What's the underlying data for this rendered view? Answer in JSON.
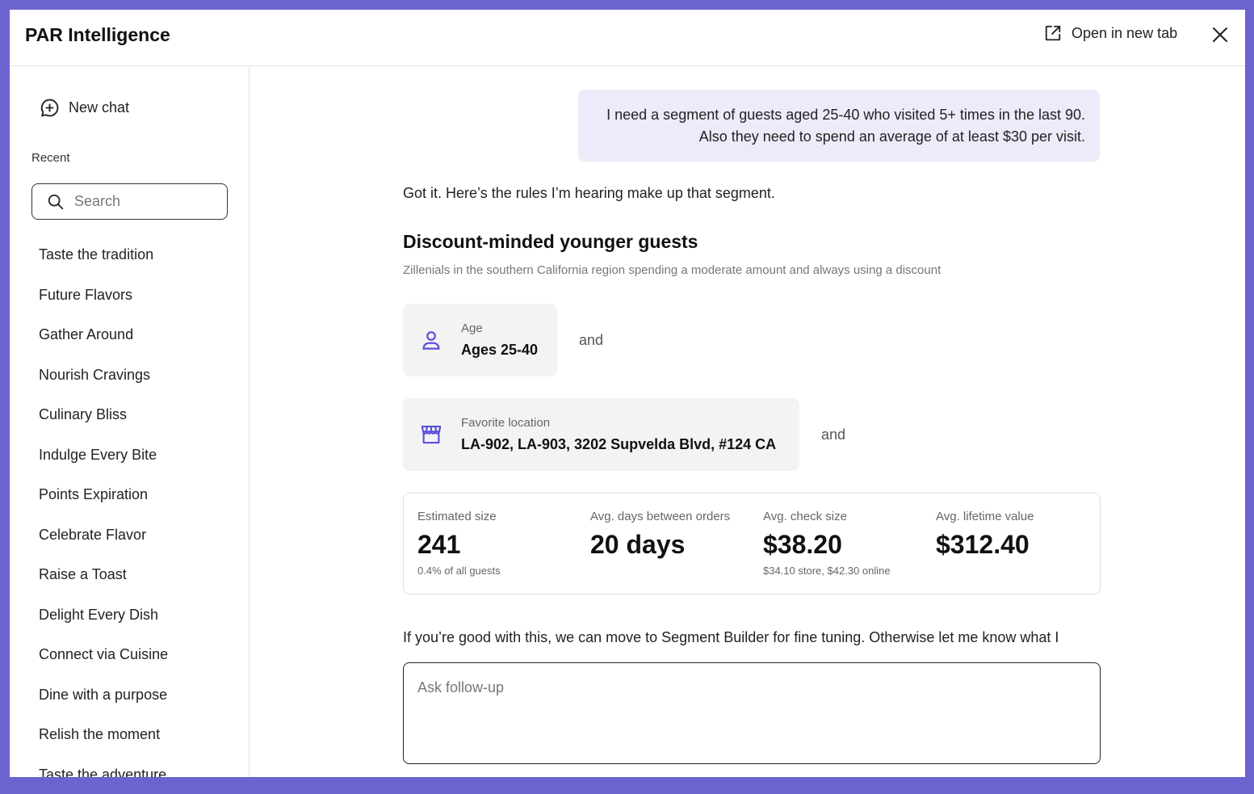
{
  "header": {
    "app_title": "PAR Intelligence",
    "open_new_tab_label": "Open in new tab"
  },
  "sidebar": {
    "new_chat_label": "New chat",
    "recent_label": "Recent",
    "search_placeholder": "Search",
    "recent_items": [
      "Taste the tradition",
      "Future Flavors",
      "Gather Around",
      "Nourish Cravings",
      "Culinary Bliss",
      "Indulge Every Bite",
      "Points Expiration",
      "Celebrate Flavor",
      "Raise a Toast",
      "Delight Every Dish",
      "Connect via Cuisine",
      "Dine with a purpose",
      "Relish the moment",
      "Taste the adventure"
    ]
  },
  "chat": {
    "user_message_line1": "I need a segment of guests aged 25-40 who visited 5+ times in the last 90.",
    "user_message_line2": "Also they need to spend an average of at least $30 per visit.",
    "reply_intro": "Got it. Here’s the rules I’m hearing make up that segment.",
    "segment": {
      "title": "Discount-minded younger guests",
      "description": "Zillenials in the southern California region spending a moderate amount and always using a discount",
      "rules": [
        {
          "label": "Age",
          "value": "Ages 25-40",
          "connector": "and"
        },
        {
          "label": "Favorite location",
          "value": "LA-902, LA-903, 3202 Supvelda Blvd, #124 CA",
          "connector": "and"
        }
      ],
      "stats": [
        {
          "label": "Estimated size",
          "value": "241",
          "sub": "0.4% of all guests"
        },
        {
          "label": "Avg. days between orders",
          "value": "20 days",
          "sub": ""
        },
        {
          "label": "Avg. check size",
          "value": "$38.20",
          "sub": "$34.10 store, $42.30 online"
        },
        {
          "label": "Avg. lifetime value",
          "value": "$312.40",
          "sub": ""
        }
      ]
    },
    "followup_text": "If you’re good with this, we can move to Segment Builder for fine tuning. Otherwise let me know what I should change here.",
    "ask_placeholder": "Ask follow-up"
  },
  "colors": {
    "frame": "#6b63cf",
    "accent": "#5b52d6",
    "user_bubble": "#ecebfa",
    "rule_card": "#f3f3f3"
  },
  "icons": {
    "new_chat": "chat-plus-icon",
    "search": "search-icon",
    "open_new_tab": "external-link-icon",
    "close": "close-icon",
    "age_rule": "person-icon",
    "location_rule": "storefront-icon"
  }
}
